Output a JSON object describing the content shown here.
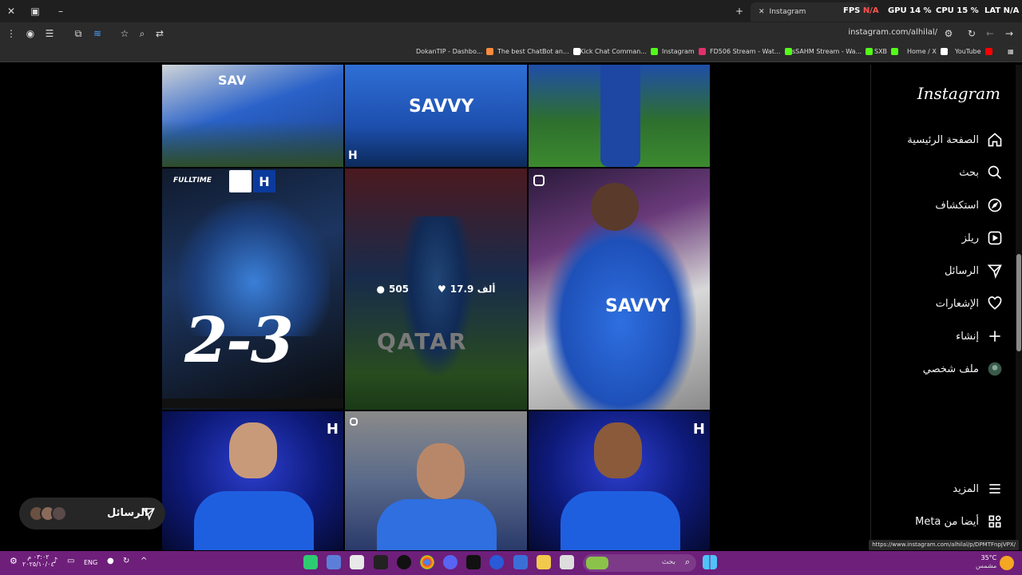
{
  "browser": {
    "tab_title": "Instagram",
    "tab_title2": "",
    "fps_label": "FPS",
    "fps_value": "N/A",
    "gpu_label": "GPU",
    "gpu_value": "14 %",
    "cpu_label": "CPU",
    "cpu_value": "15 %",
    "lat_label": "LAT",
    "lat_value": "N/A",
    "url": "instagram.com/alhilal/",
    "bookmarks": [
      {
        "label": "DokanTIP - Dashbo...",
        "color": "#ff8a3d"
      },
      {
        "label": "The best ChatBot an...",
        "color": "#ffffff"
      },
      {
        "label": "Kick Chat Comman...",
        "color": "#53fc18"
      },
      {
        "label": "Instagram",
        "color": "#e1306c"
      },
      {
        "label": "FD506 Stream - Wat...",
        "color": "#53fc18"
      },
      {
        "label": "sSAHM Stream - Wa...",
        "color": "#53fc18"
      },
      {
        "label": "SXB",
        "color": "#53fc18"
      },
      {
        "label": "Home / X",
        "color": "#ffffff"
      },
      {
        "label": "YouTube",
        "color": "#ff0000"
      }
    ]
  },
  "grid": {
    "hovered_post": {
      "likes": "17.9 ألف",
      "comments": "505"
    },
    "scoreline": "2-3",
    "fulltime_label": "FULLTIME"
  },
  "sidebar": {
    "logo": "Instagram",
    "items": [
      {
        "label": "الصفحة الرئيسية",
        "icon": "home-icon"
      },
      {
        "label": "بحث",
        "icon": "search-icon"
      },
      {
        "label": "استكشاف",
        "icon": "explore-icon"
      },
      {
        "label": "ريلز",
        "icon": "reels-icon"
      },
      {
        "label": "الرسائل",
        "icon": "messages-icon"
      },
      {
        "label": "الإشعارات",
        "icon": "heart-icon"
      },
      {
        "label": "إنشاء",
        "icon": "plus-icon"
      },
      {
        "label": "ملف شخصي",
        "icon": "profile-icon"
      }
    ],
    "more": "المزيد",
    "meta": "أيضا من Meta"
  },
  "messages_pill": {
    "label": "الرسائل"
  },
  "status_url": "https://www.instagram.com/alhilal/p/DPMTFnpjVPX/",
  "taskbar": {
    "search_placeholder": "بحث",
    "weather_temp": "35°C",
    "weather_text": "مشمس",
    "lang": "ENG",
    "clock_time": "٠٣:٠٢ م",
    "clock_date": "٢٠٢٥/١٠/٠٤"
  },
  "colors": {
    "hilal_blue": "#1e63d8",
    "taskbar": "#6e1f7a",
    "sidebar_bg": "#000000"
  }
}
